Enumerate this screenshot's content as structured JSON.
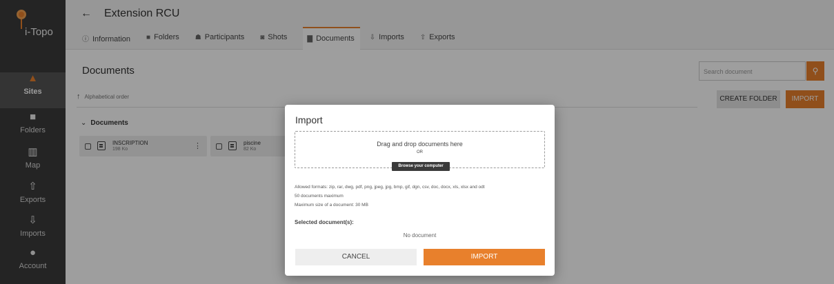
{
  "app": {
    "logo_text": "i-Topo"
  },
  "sidebar": {
    "items": [
      {
        "label": "Sites",
        "icon": "cone-icon"
      },
      {
        "label": "Folders",
        "icon": "folder-icon"
      },
      {
        "label": "Map",
        "icon": "map-icon"
      },
      {
        "label": "Exports",
        "icon": "upload-icon"
      },
      {
        "label": "Imports",
        "icon": "download-icon"
      },
      {
        "label": "Account",
        "icon": "person-icon"
      }
    ],
    "active": "Sites"
  },
  "header": {
    "back_glyph": "←",
    "title": "Extension RCU",
    "tabs": [
      {
        "label": "Information",
        "icon": "info-icon"
      },
      {
        "label": "Folders",
        "icon": "folder-icon"
      },
      {
        "label": "Participants",
        "icon": "people-icon"
      },
      {
        "label": "Shots",
        "icon": "camera-icon"
      },
      {
        "label": "Documents",
        "icon": "document-icon"
      },
      {
        "label": "Imports",
        "icon": "download-icon"
      },
      {
        "label": "Exports",
        "icon": "upload-icon"
      }
    ],
    "active_tab": "Documents"
  },
  "main": {
    "title": "Documents",
    "sort_label": "Alphabetical order",
    "group_label": "Documents",
    "files": [
      {
        "name": "INSCRIPTION",
        "size": "198 Ko"
      },
      {
        "name": "piscine",
        "size": "82 Ko"
      }
    ],
    "search_placeholder": "Search document",
    "create_folder_label": "CREATE FOLDER",
    "import_label": "IMPORT"
  },
  "modal": {
    "title": "Import",
    "drop_text": "Drag and drop documents here",
    "or_text": "OR",
    "browse_label": "Browse your computer",
    "allowed_formats": "Allowed formats: zip, rar, dwg, pdf, png, jpeg, jpg, bmp, gif, dgn, csv, doc, docx, xls, xlsx and odt",
    "max_docs": "50 documents maximum",
    "max_size": "Maximum size of a document: 30 MB",
    "selected_label": "Selected document(s):",
    "no_document": "No document",
    "cancel_label": "CANCEL",
    "import_label": "IMPORT"
  },
  "colors": {
    "accent": "#e8802c",
    "sidebar": "#3a3a3a"
  }
}
